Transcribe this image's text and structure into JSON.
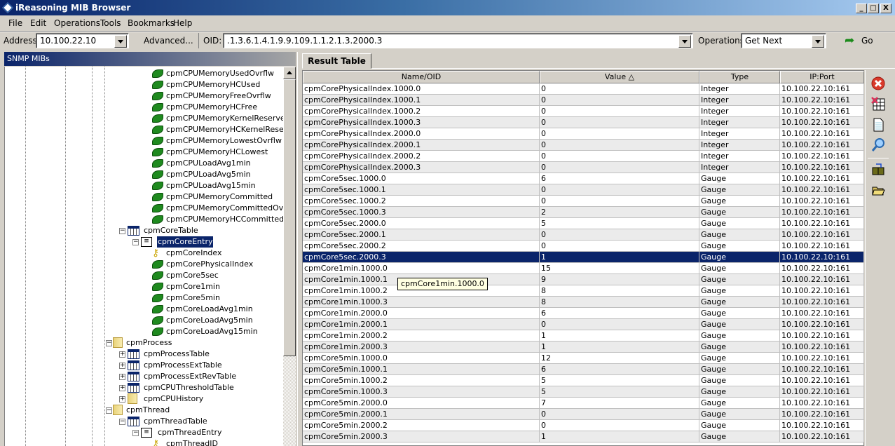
{
  "window": {
    "title": "iReasoning MIB Browser",
    "min": "_",
    "max": "□",
    "close": "X"
  },
  "menu": [
    "File",
    "Edit",
    "Operations",
    "Tools",
    "Bookmarks",
    "Help"
  ],
  "toolbar": {
    "address_label": "Address:",
    "address": "10.100.22.10",
    "advanced": "Advanced...",
    "oid_label": "OID:",
    "oid": ".1.3.6.1.4.1.9.9.109.1.1.2.1.3.2000.3",
    "operations_label": "Operations:",
    "operation": "Get Next",
    "go": "Go"
  },
  "left_panel": {
    "title": "SNMP MIBs"
  },
  "tree": [
    {
      "label": "cpmCPUMemoryUsedOvrflw",
      "icon": "leaf",
      "level": 4
    },
    {
      "label": "cpmCPUMemoryHCUsed",
      "icon": "leaf",
      "level": 4
    },
    {
      "label": "cpmCPUMemoryFreeOvrflw",
      "icon": "leaf",
      "level": 4
    },
    {
      "label": "cpmCPUMemoryHCFree",
      "icon": "leaf",
      "level": 4
    },
    {
      "label": "cpmCPUMemoryKernelReservedOvrflw",
      "icon": "leaf",
      "level": 4
    },
    {
      "label": "cpmCPUMemoryHCKernelReserved",
      "icon": "leaf",
      "level": 4
    },
    {
      "label": "cpmCPUMemoryLowestOvrflw",
      "icon": "leaf",
      "level": 4
    },
    {
      "label": "cpmCPUMemoryHCLowest",
      "icon": "leaf",
      "level": 4
    },
    {
      "label": "cpmCPULoadAvg1min",
      "icon": "leaf",
      "level": 4
    },
    {
      "label": "cpmCPULoadAvg5min",
      "icon": "leaf",
      "level": 4
    },
    {
      "label": "cpmCPULoadAvg15min",
      "icon": "leaf",
      "level": 4
    },
    {
      "label": "cpmCPUMemoryCommitted",
      "icon": "leaf",
      "level": 4
    },
    {
      "label": "cpmCPUMemoryCommittedOvrflw",
      "icon": "leaf",
      "level": 4
    },
    {
      "label": "cpmCPUMemoryHCCommitted",
      "icon": "leaf",
      "level": 4
    },
    {
      "label": "cpmCoreTable",
      "icon": "table",
      "level": 2,
      "expander": "-"
    },
    {
      "label": "cpmCoreEntry",
      "icon": "entry",
      "level": 3,
      "expander": "-",
      "selected": true
    },
    {
      "label": "cpmCoreIndex",
      "icon": "key",
      "level": 4
    },
    {
      "label": "cpmCorePhysicalIndex",
      "icon": "leaf",
      "level": 4
    },
    {
      "label": "cpmCore5sec",
      "icon": "leaf",
      "level": 4
    },
    {
      "label": "cpmCore1min",
      "icon": "leaf",
      "level": 4
    },
    {
      "label": "cpmCore5min",
      "icon": "leaf",
      "level": 4
    },
    {
      "label": "cpmCoreLoadAvg1min",
      "icon": "leaf",
      "level": 4
    },
    {
      "label": "cpmCoreLoadAvg5min",
      "icon": "leaf",
      "level": 4
    },
    {
      "label": "cpmCoreLoadAvg15min",
      "icon": "leaf",
      "level": 4
    },
    {
      "label": "cpmProcess",
      "icon": "folder",
      "level": 1,
      "expander": "-"
    },
    {
      "label": "cpmProcessTable",
      "icon": "table",
      "level": 2,
      "expander": "+"
    },
    {
      "label": "cpmProcessExtTable",
      "icon": "table",
      "level": 2,
      "expander": "+"
    },
    {
      "label": "cpmProcessExtRevTable",
      "icon": "table",
      "level": 2,
      "expander": "+"
    },
    {
      "label": "cpmCPUThresholdTable",
      "icon": "table",
      "level": 2,
      "expander": "+"
    },
    {
      "label": "cpmCPUHistory",
      "icon": "folder",
      "level": 2,
      "expander": "+"
    },
    {
      "label": "cpmThread",
      "icon": "folder",
      "level": 1,
      "expander": "-"
    },
    {
      "label": "cpmThreadTable",
      "icon": "table",
      "level": 2,
      "expander": "-"
    },
    {
      "label": "cpmThreadEntry",
      "icon": "entry",
      "level": 3,
      "expander": "-"
    },
    {
      "label": "cpmThreadID",
      "icon": "key",
      "level": 4
    }
  ],
  "result": {
    "tab": "Result Table",
    "columns": [
      "Name/OID",
      "Value △",
      "Type",
      "IP:Port"
    ],
    "rows": [
      [
        "cpmCorePhysicalIndex.1000.0",
        "0",
        "Integer",
        "10.100.22.10:161"
      ],
      [
        "cpmCorePhysicalIndex.1000.1",
        "0",
        "Integer",
        "10.100.22.10:161"
      ],
      [
        "cpmCorePhysicalIndex.1000.2",
        "0",
        "Integer",
        "10.100.22.10:161"
      ],
      [
        "cpmCorePhysicalIndex.1000.3",
        "0",
        "Integer",
        "10.100.22.10:161"
      ],
      [
        "cpmCorePhysicalIndex.2000.0",
        "0",
        "Integer",
        "10.100.22.10:161"
      ],
      [
        "cpmCorePhysicalIndex.2000.1",
        "0",
        "Integer",
        "10.100.22.10:161"
      ],
      [
        "cpmCorePhysicalIndex.2000.2",
        "0",
        "Integer",
        "10.100.22.10:161"
      ],
      [
        "cpmCorePhysicalIndex.2000.3",
        "0",
        "Integer",
        "10.100.22.10:161"
      ],
      [
        "cpmCore5sec.1000.0",
        "6",
        "Gauge",
        "10.100.22.10:161"
      ],
      [
        "cpmCore5sec.1000.1",
        "0",
        "Gauge",
        "10.100.22.10:161"
      ],
      [
        "cpmCore5sec.1000.2",
        "0",
        "Gauge",
        "10.100.22.10:161"
      ],
      [
        "cpmCore5sec.1000.3",
        "2",
        "Gauge",
        "10.100.22.10:161"
      ],
      [
        "cpmCore5sec.2000.0",
        "5",
        "Gauge",
        "10.100.22.10:161"
      ],
      [
        "cpmCore5sec.2000.1",
        "0",
        "Gauge",
        "10.100.22.10:161"
      ],
      [
        "cpmCore5sec.2000.2",
        "0",
        "Gauge",
        "10.100.22.10:161"
      ],
      [
        "cpmCore5sec.2000.3",
        "1",
        "Gauge",
        "10.100.22.10:161"
      ],
      [
        "cpmCore1min.1000.0",
        "15",
        "Gauge",
        "10.100.22.10:161"
      ],
      [
        "cpmCore1min.1000.1",
        "9",
        "Gauge",
        "10.100.22.10:161"
      ],
      [
        "cpmCore1min.1000.2",
        "8",
        "Gauge",
        "10.100.22.10:161"
      ],
      [
        "cpmCore1min.1000.3",
        "8",
        "Gauge",
        "10.100.22.10:161"
      ],
      [
        "cpmCore1min.2000.0",
        "6",
        "Gauge",
        "10.100.22.10:161"
      ],
      [
        "cpmCore1min.2000.1",
        "0",
        "Gauge",
        "10.100.22.10:161"
      ],
      [
        "cpmCore1min.2000.2",
        "1",
        "Gauge",
        "10.100.22.10:161"
      ],
      [
        "cpmCore1min.2000.3",
        "1",
        "Gauge",
        "10.100.22.10:161"
      ],
      [
        "cpmCore5min.1000.0",
        "12",
        "Gauge",
        "10.100.22.10:161"
      ],
      [
        "cpmCore5min.1000.1",
        "6",
        "Gauge",
        "10.100.22.10:161"
      ],
      [
        "cpmCore5min.1000.2",
        "5",
        "Gauge",
        "10.100.22.10:161"
      ],
      [
        "cpmCore5min.1000.3",
        "5",
        "Gauge",
        "10.100.22.10:161"
      ],
      [
        "cpmCore5min.2000.0",
        "7",
        "Gauge",
        "10.100.22.10:161"
      ],
      [
        "cpmCore5min.2000.1",
        "0",
        "Gauge",
        "10.100.22.10:161"
      ],
      [
        "cpmCore5min.2000.2",
        "0",
        "Gauge",
        "10.100.22.10:161"
      ],
      [
        "cpmCore5min.2000.3",
        "1",
        "Gauge",
        "10.100.22.10:161"
      ]
    ],
    "selected_row": 15,
    "tooltip": "cpmCore1min.1000.0"
  },
  "side_toolbar": [
    "stop-icon",
    "clear-table-icon",
    "new-document-icon",
    "find-icon",
    "save-icon",
    "open-folder-icon"
  ],
  "colors": {
    "selection": "#0a246a",
    "title_start": "#0a246a",
    "title_end": "#a6caf0"
  }
}
